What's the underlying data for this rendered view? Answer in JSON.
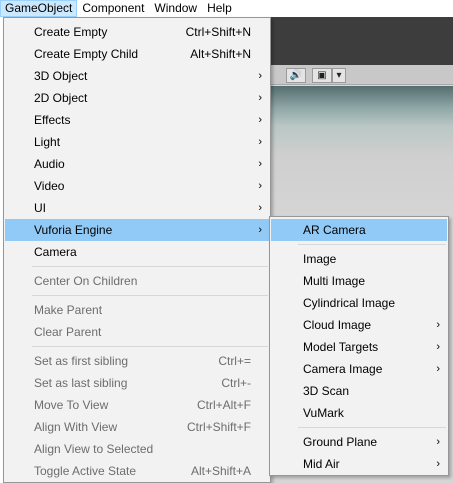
{
  "menubar": {
    "items": [
      "GameObject",
      "Component",
      "Window",
      "Help"
    ]
  },
  "scene": {
    "audio_glyph": "🔊",
    "image_glyph": "▣",
    "dropdown_glyph": "▾"
  },
  "gameobject_menu": {
    "items": [
      {
        "label": "Create Empty",
        "shortcut": "Ctrl+Shift+N"
      },
      {
        "label": "Create Empty Child",
        "shortcut": "Alt+Shift+N"
      },
      {
        "label": "3D Object",
        "arrow": "›"
      },
      {
        "label": "2D Object",
        "arrow": "›"
      },
      {
        "label": "Effects",
        "arrow": "›"
      },
      {
        "label": "Light",
        "arrow": "›"
      },
      {
        "label": "Audio",
        "arrow": "›"
      },
      {
        "label": "Video",
        "arrow": "›"
      },
      {
        "label": "UI",
        "arrow": "›"
      },
      {
        "label": "Vuforia Engine",
        "arrow": "›"
      },
      {
        "label": "Camera"
      },
      {
        "label": "Center On Children"
      },
      {
        "label": "Make Parent"
      },
      {
        "label": "Clear Parent"
      },
      {
        "label": "Set as first sibling",
        "shortcut": "Ctrl+="
      },
      {
        "label": "Set as last sibling",
        "shortcut": "Ctrl+-"
      },
      {
        "label": "Move To View",
        "shortcut": "Ctrl+Alt+F"
      },
      {
        "label": "Align With View",
        "shortcut": "Ctrl+Shift+F"
      },
      {
        "label": "Align View to Selected"
      },
      {
        "label": "Toggle Active State",
        "shortcut": "Alt+Shift+A"
      }
    ]
  },
  "vuforia_menu": {
    "items": [
      {
        "label": "AR Camera"
      },
      {
        "label": "Image"
      },
      {
        "label": "Multi Image"
      },
      {
        "label": "Cylindrical Image"
      },
      {
        "label": "Cloud Image",
        "arrow": "›"
      },
      {
        "label": "Model Targets",
        "arrow": "›"
      },
      {
        "label": "Camera Image",
        "arrow": "›"
      },
      {
        "label": "3D Scan"
      },
      {
        "label": "VuMark"
      },
      {
        "label": "Ground Plane",
        "arrow": "›"
      },
      {
        "label": "Mid Air",
        "arrow": "›"
      }
    ]
  }
}
